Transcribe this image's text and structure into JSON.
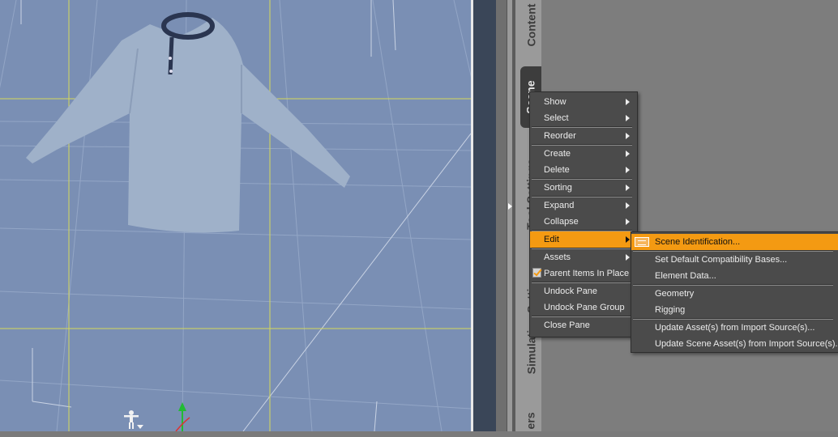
{
  "sidebar": {
    "tabs": [
      {
        "label": "Content",
        "active": false
      },
      {
        "label": "Scene",
        "active": true
      },
      {
        "label": "Tool Settings",
        "active": false
      },
      {
        "label": "Simulation Settings",
        "active": false
      },
      {
        "label": "ers",
        "active": false
      }
    ]
  },
  "context_menu": {
    "items": [
      {
        "label": "Show",
        "submenu": true
      },
      {
        "label": "Select",
        "submenu": true
      },
      {
        "label": "Reorder",
        "submenu": true
      },
      {
        "label": "Create",
        "submenu": true
      },
      {
        "label": "Delete",
        "submenu": true
      },
      {
        "label": "Sorting",
        "submenu": true
      },
      {
        "label": "Expand",
        "submenu": true
      },
      {
        "label": "Collapse",
        "submenu": true
      },
      {
        "label": "Edit",
        "submenu": true,
        "highlighted": true
      },
      {
        "label": "Assets",
        "submenu": true
      },
      {
        "label": "Parent Items In Place",
        "checked": true
      },
      {
        "label": "Undock Pane"
      },
      {
        "label": "Undock Pane Group"
      },
      {
        "label": "Close Pane"
      }
    ]
  },
  "edit_submenu": {
    "items": [
      {
        "label": "Scene Identification...",
        "highlighted": true,
        "icon": "scene-identification-icon"
      },
      {
        "label": "Set Default Compatibility Bases..."
      },
      {
        "label": "Element Data..."
      },
      {
        "label": "Geometry"
      },
      {
        "label": "Rigging"
      },
      {
        "label": "Update Asset(s) from Import Source(s)..."
      },
      {
        "label": "Update Scene Asset(s) from Import Source(s)..."
      }
    ]
  },
  "viewport": {
    "background": "#7a8fb4",
    "accent_color": "#f49a12",
    "guide_color": "#d6d85a"
  }
}
